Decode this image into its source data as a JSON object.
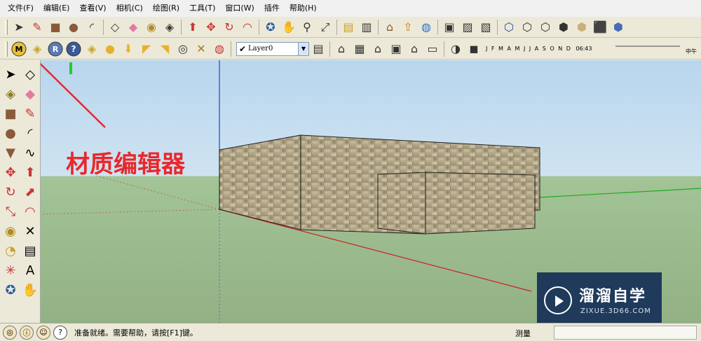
{
  "menu": {
    "items": [
      "文件(F)",
      "编辑(E)",
      "查看(V)",
      "相机(C)",
      "绘图(R)",
      "工具(T)",
      "窗口(W)",
      "插件",
      "帮助(H)"
    ]
  },
  "toolbar": {
    "layer_name": "Layer0",
    "months": "J F M A M J J A S O N D",
    "time": "06:43",
    "midday": "中午"
  },
  "viewport": {
    "annotation": "材质编辑器",
    "watermark_title": "溜溜自学",
    "watermark_sub": "ZIXUE.3D66.COM"
  },
  "status": {
    "text": "准备就绪。需要帮助，请按[F1]键。",
    "measure_label": "测量",
    "measure_value": ""
  },
  "colors": {
    "annotation": "#e8282d",
    "sky": "#b8d6ee",
    "ground": "#9fbd92",
    "x_axis": "#cc2222",
    "y_axis": "#22aa22",
    "z_axis": "#2244cc"
  }
}
